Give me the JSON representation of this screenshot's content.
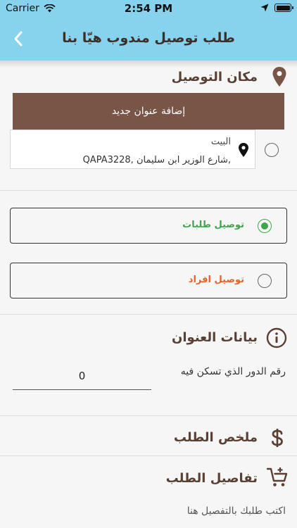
{
  "status_bar": {
    "carrier": "Carrier",
    "time": "2:54 PM"
  },
  "header": {
    "title": "طلب توصيل مندوب هيّا بنا"
  },
  "delivery_place": {
    "title": "مكان التوصيل",
    "add_button": "إضافة عنوان جديد",
    "addresses": [
      {
        "name": "البيت",
        "line": "QAPA3228, شارع الوزير ابن سليمان,"
      }
    ]
  },
  "delivery_options": [
    {
      "label": "توصيل طلبات",
      "selected": true,
      "color": "#3fa64e"
    },
    {
      "label": "توصيل افراد",
      "selected": false,
      "color": "#e8602c"
    }
  ],
  "address_data": {
    "title": "بيانات العنوان",
    "floor_label": "رقم الدور الذي تسكن فيه",
    "floor_value": "0"
  },
  "order_summary": {
    "title": "ملخص الطلب"
  },
  "order_details": {
    "title": "تفاصيل الطلب",
    "placeholder": "اكتب طلبك بالتفصيل هنا"
  },
  "colors": {
    "header_bg": "#87d3ee",
    "primary_brown": "#795548",
    "title_brown": "#5a4034",
    "selected_green": "#3fa64e",
    "alert_orange": "#e8602c"
  }
}
